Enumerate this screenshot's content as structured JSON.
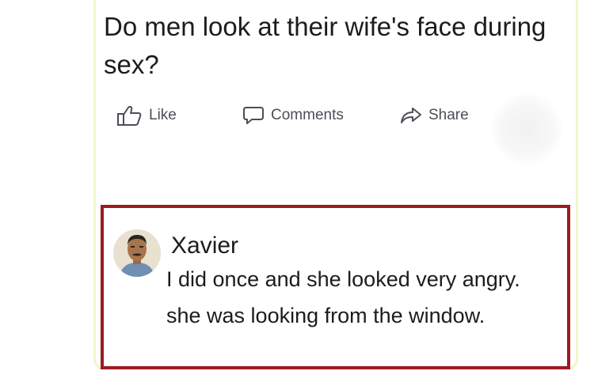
{
  "post": {
    "question": "Do men look at their wife's face during sex?"
  },
  "actions": {
    "like_label": "Like",
    "comments_label": "Comments",
    "share_label": "Share"
  },
  "comment": {
    "author": "Xavier",
    "line1": "I did once and she looked very angry.",
    "line2": "she was looking from the window.",
    "highlight_color": "#9c1b1f"
  },
  "icons": [
    "thumbs-up-icon",
    "comment-bubble-icon",
    "share-arrow-icon"
  ]
}
